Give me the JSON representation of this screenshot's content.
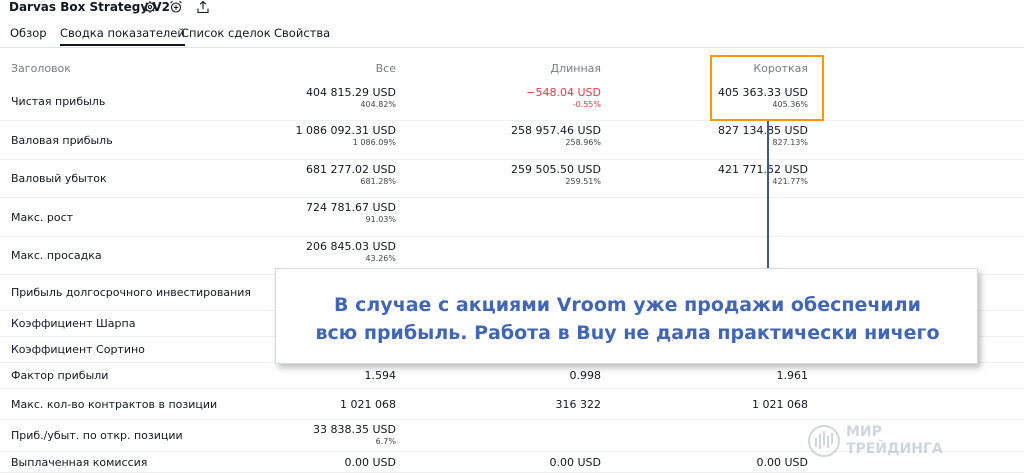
{
  "header": {
    "title": "Darvas Box Strategy V2"
  },
  "icons": {
    "settings": "gear-icon",
    "add_alert": "alarm-plus-icon",
    "export": "share-icon"
  },
  "tabs": [
    {
      "label": "Обзор",
      "active": false
    },
    {
      "label": "Сводка показателей",
      "active": true
    },
    {
      "label": "Список сделок",
      "active": false
    },
    {
      "label": "Свойства",
      "active": false
    }
  ],
  "table": {
    "columns": {
      "title": "Заголовок",
      "all": "Все",
      "long": "Длинная",
      "short": "Короткая"
    },
    "rows": [
      {
        "label": "Чистая прибыль",
        "all": {
          "v": "404 815.29 USD",
          "p": "404.82%"
        },
        "long": {
          "v": "−548.04 USD",
          "p": "-0.55%"
        },
        "short": {
          "v": "405 363.33 USD",
          "p": "405.36%"
        }
      },
      {
        "label": "Валовая прибыль",
        "all": {
          "v": "1 086 092.31 USD",
          "p": "1 086.09%"
        },
        "long": {
          "v": "258 957.46 USD",
          "p": "258.96%"
        },
        "short": {
          "v": "827 134.85 USD",
          "p": "827.13%"
        }
      },
      {
        "label": "Валовый убыток",
        "all": {
          "v": "681 277.02 USD",
          "p": "681.28%"
        },
        "long": {
          "v": "259 505.50 USD",
          "p": "259.51%"
        },
        "short": {
          "v": "421 771.52 USD",
          "p": "421.77%"
        }
      },
      {
        "label": "Макс. рост",
        "all": {
          "v": "724 781.67 USD",
          "p": "91.03%"
        }
      },
      {
        "label": "Макс. просадка",
        "all": {
          "v": "206 845.03 USD",
          "p": "43.26%"
        }
      },
      {
        "label": "Прибыль долгосрочного инвестирования"
      },
      {
        "label": "Коэффициент Шарпа"
      },
      {
        "label": "Коэффициент Сортино"
      },
      {
        "label": "Фактор прибыли",
        "all": {
          "v": "1.594"
        },
        "long": {
          "v": "0.998"
        },
        "short": {
          "v": "1.961"
        }
      },
      {
        "label": "Макс. кол-во контрактов в позиции",
        "all": {
          "v": "1 021 068"
        },
        "long": {
          "v": "316 322"
        },
        "short": {
          "v": "1 021 068"
        }
      },
      {
        "label": "Приб./убыт. по откр. позиции",
        "all": {
          "v": "33 838.35 USD",
          "p": "6.7%"
        }
      },
      {
        "label": "Выплаченная комиссия",
        "all": {
          "v": "0.00 USD"
        },
        "long": {
          "v": "0.00 USD"
        },
        "short": {
          "v": "0.00 USD"
        }
      }
    ]
  },
  "callout": {
    "line1": "В случае с акциями Vroom уже продажи обеспечили",
    "line2": "всю прибыль. Работа в Buy не дала практически ничего"
  },
  "watermark": {
    "line1": "МИР",
    "line2": "ТРЕЙДИНГА"
  },
  "colors": {
    "negative": "#f23645",
    "highlight": "#ff9800",
    "callout_text": "#4166b2"
  }
}
